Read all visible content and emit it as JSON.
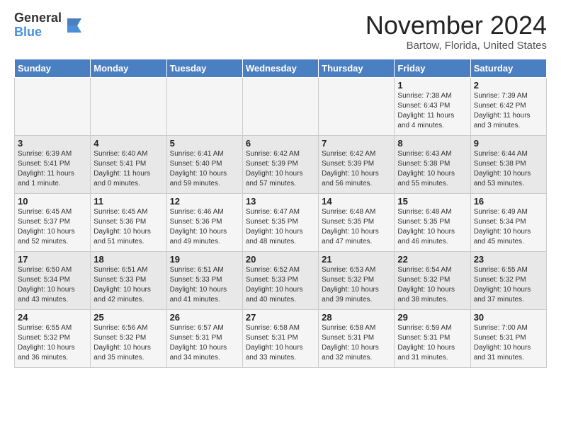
{
  "logo": {
    "general": "General",
    "blue": "Blue"
  },
  "title": "November 2024",
  "location": "Bartow, Florida, United States",
  "headers": [
    "Sunday",
    "Monday",
    "Tuesday",
    "Wednesday",
    "Thursday",
    "Friday",
    "Saturday"
  ],
  "weeks": [
    [
      {
        "day": "",
        "info": ""
      },
      {
        "day": "",
        "info": ""
      },
      {
        "day": "",
        "info": ""
      },
      {
        "day": "",
        "info": ""
      },
      {
        "day": "",
        "info": ""
      },
      {
        "day": "1",
        "info": "Sunrise: 7:38 AM\nSunset: 6:43 PM\nDaylight: 11 hours\nand 4 minutes."
      },
      {
        "day": "2",
        "info": "Sunrise: 7:39 AM\nSunset: 6:42 PM\nDaylight: 11 hours\nand 3 minutes."
      }
    ],
    [
      {
        "day": "3",
        "info": "Sunrise: 6:39 AM\nSunset: 5:41 PM\nDaylight: 11 hours\nand 1 minute."
      },
      {
        "day": "4",
        "info": "Sunrise: 6:40 AM\nSunset: 5:41 PM\nDaylight: 11 hours\nand 0 minutes."
      },
      {
        "day": "5",
        "info": "Sunrise: 6:41 AM\nSunset: 5:40 PM\nDaylight: 10 hours\nand 59 minutes."
      },
      {
        "day": "6",
        "info": "Sunrise: 6:42 AM\nSunset: 5:39 PM\nDaylight: 10 hours\nand 57 minutes."
      },
      {
        "day": "7",
        "info": "Sunrise: 6:42 AM\nSunset: 5:39 PM\nDaylight: 10 hours\nand 56 minutes."
      },
      {
        "day": "8",
        "info": "Sunrise: 6:43 AM\nSunset: 5:38 PM\nDaylight: 10 hours\nand 55 minutes."
      },
      {
        "day": "9",
        "info": "Sunrise: 6:44 AM\nSunset: 5:38 PM\nDaylight: 10 hours\nand 53 minutes."
      }
    ],
    [
      {
        "day": "10",
        "info": "Sunrise: 6:45 AM\nSunset: 5:37 PM\nDaylight: 10 hours\nand 52 minutes."
      },
      {
        "day": "11",
        "info": "Sunrise: 6:45 AM\nSunset: 5:36 PM\nDaylight: 10 hours\nand 51 minutes."
      },
      {
        "day": "12",
        "info": "Sunrise: 6:46 AM\nSunset: 5:36 PM\nDaylight: 10 hours\nand 49 minutes."
      },
      {
        "day": "13",
        "info": "Sunrise: 6:47 AM\nSunset: 5:35 PM\nDaylight: 10 hours\nand 48 minutes."
      },
      {
        "day": "14",
        "info": "Sunrise: 6:48 AM\nSunset: 5:35 PM\nDaylight: 10 hours\nand 47 minutes."
      },
      {
        "day": "15",
        "info": "Sunrise: 6:48 AM\nSunset: 5:35 PM\nDaylight: 10 hours\nand 46 minutes."
      },
      {
        "day": "16",
        "info": "Sunrise: 6:49 AM\nSunset: 5:34 PM\nDaylight: 10 hours\nand 45 minutes."
      }
    ],
    [
      {
        "day": "17",
        "info": "Sunrise: 6:50 AM\nSunset: 5:34 PM\nDaylight: 10 hours\nand 43 minutes."
      },
      {
        "day": "18",
        "info": "Sunrise: 6:51 AM\nSunset: 5:33 PM\nDaylight: 10 hours\nand 42 minutes."
      },
      {
        "day": "19",
        "info": "Sunrise: 6:51 AM\nSunset: 5:33 PM\nDaylight: 10 hours\nand 41 minutes."
      },
      {
        "day": "20",
        "info": "Sunrise: 6:52 AM\nSunset: 5:33 PM\nDaylight: 10 hours\nand 40 minutes."
      },
      {
        "day": "21",
        "info": "Sunrise: 6:53 AM\nSunset: 5:32 PM\nDaylight: 10 hours\nand 39 minutes."
      },
      {
        "day": "22",
        "info": "Sunrise: 6:54 AM\nSunset: 5:32 PM\nDaylight: 10 hours\nand 38 minutes."
      },
      {
        "day": "23",
        "info": "Sunrise: 6:55 AM\nSunset: 5:32 PM\nDaylight: 10 hours\nand 37 minutes."
      }
    ],
    [
      {
        "day": "24",
        "info": "Sunrise: 6:55 AM\nSunset: 5:32 PM\nDaylight: 10 hours\nand 36 minutes."
      },
      {
        "day": "25",
        "info": "Sunrise: 6:56 AM\nSunset: 5:32 PM\nDaylight: 10 hours\nand 35 minutes."
      },
      {
        "day": "26",
        "info": "Sunrise: 6:57 AM\nSunset: 5:31 PM\nDaylight: 10 hours\nand 34 minutes."
      },
      {
        "day": "27",
        "info": "Sunrise: 6:58 AM\nSunset: 5:31 PM\nDaylight: 10 hours\nand 33 minutes."
      },
      {
        "day": "28",
        "info": "Sunrise: 6:58 AM\nSunset: 5:31 PM\nDaylight: 10 hours\nand 32 minutes."
      },
      {
        "day": "29",
        "info": "Sunrise: 6:59 AM\nSunset: 5:31 PM\nDaylight: 10 hours\nand 31 minutes."
      },
      {
        "day": "30",
        "info": "Sunrise: 7:00 AM\nSunset: 5:31 PM\nDaylight: 10 hours\nand 31 minutes."
      }
    ]
  ]
}
